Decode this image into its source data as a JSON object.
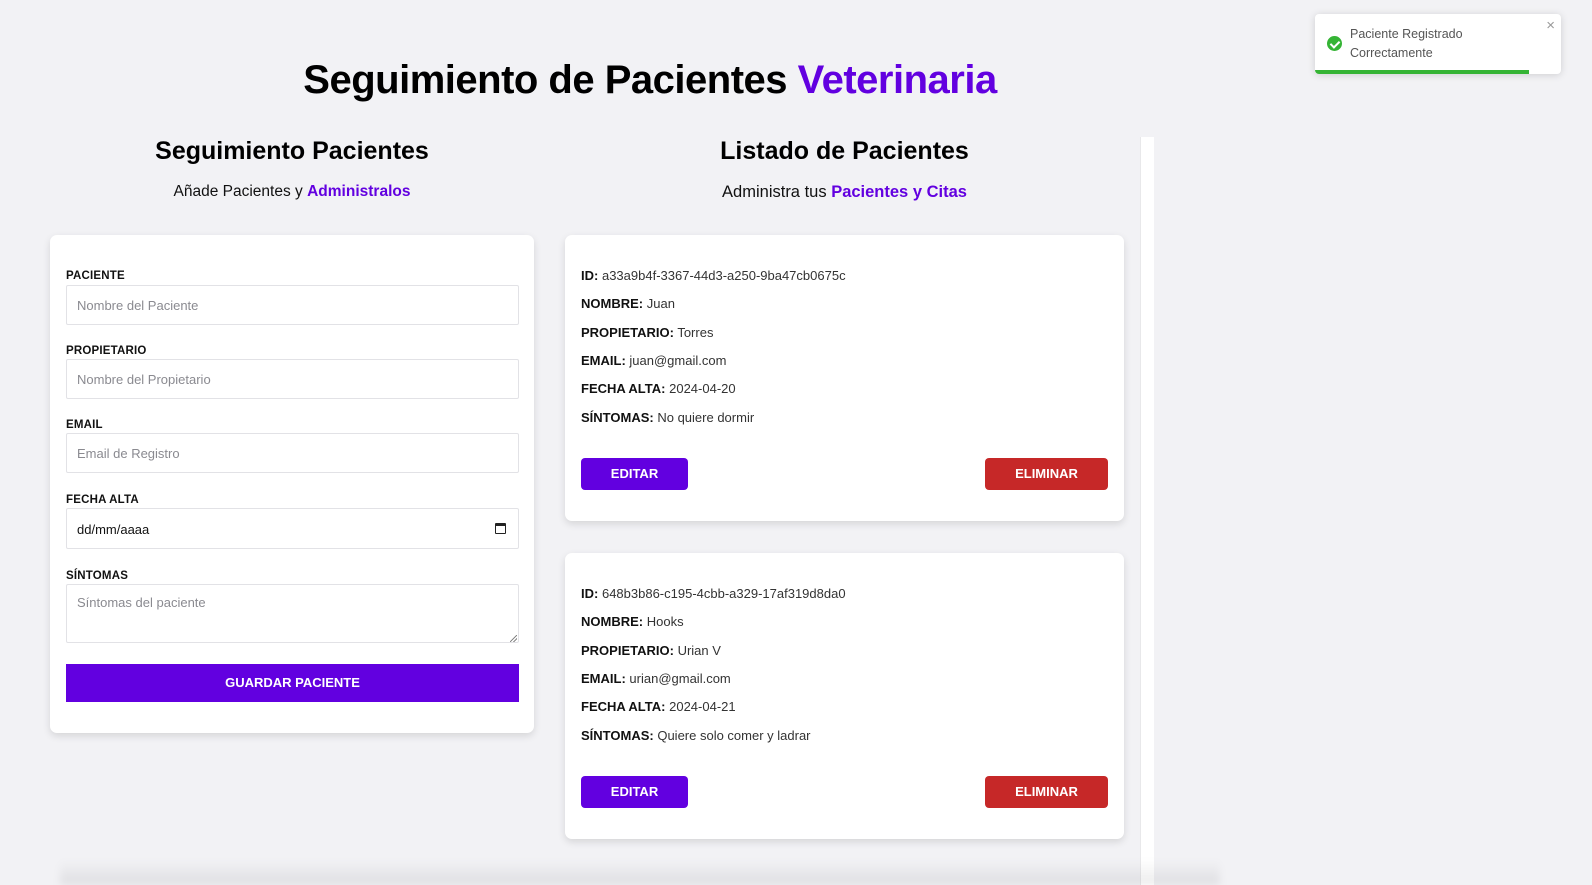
{
  "header": {
    "title": "Seguimiento de Pacientes",
    "title_accent": "Veterinaria"
  },
  "form_section": {
    "title": "Seguimiento Pacientes",
    "subtitle": "Añade Pacientes y",
    "subtitle_accent": "Administralos"
  },
  "list_section": {
    "title": "Listado de Pacientes",
    "subtitle": "Administra tus",
    "subtitle_accent": "Pacientes y Citas"
  },
  "form": {
    "fields": [
      {
        "label": "PACIENTE",
        "placeholder": "Nombre del Paciente",
        "value": ""
      },
      {
        "label": "PROPIETARIO",
        "placeholder": "Nombre del Propietario",
        "value": ""
      },
      {
        "label": "EMAIL",
        "placeholder": "Email de Registro",
        "value": ""
      },
      {
        "label": "FECHA ALTA",
        "placeholder": "dd/mm/aaaa",
        "value": ""
      },
      {
        "label": "SÍNTOMAS",
        "placeholder": "Síntomas del paciente",
        "value": ""
      }
    ],
    "submit_label": "GUARDAR PACIENTE"
  },
  "patient_labels": {
    "id": "ID:",
    "name": "NOMBRE:",
    "owner": "PROPIETARIO:",
    "email": "EMAIL:",
    "date": "FECHA ALTA:",
    "symptoms": "SÍNTOMAS:"
  },
  "patients": [
    {
      "id": "a33a9b4f-3367-44d3-a250-9ba47cb0675c",
      "name": "Juan",
      "owner": "Torres",
      "email": "juan@gmail.com",
      "date": "2024-04-20",
      "symptoms": "No quiere dormir",
      "edit_label": "EDITAR",
      "delete_label": "ELIMINAR"
    },
    {
      "id": "648b3b86-c195-4cbb-a329-17af319d8da0",
      "name": "Hooks",
      "owner": "Urian V",
      "email": "urian@gmail.com",
      "date": "2024-04-21",
      "symptoms": "Quiere solo comer y ladrar",
      "edit_label": "EDITAR",
      "delete_label": "ELIMINAR"
    }
  ],
  "toast": {
    "message": "Paciente Registrado Correctamente",
    "close_glyph": "×",
    "icon": "check-circle-icon",
    "progress_fraction": 0.87,
    "color": "#35b435"
  },
  "colors": {
    "accent": "#6200e0",
    "danger": "#c62828",
    "background": "#f2f2f5"
  }
}
